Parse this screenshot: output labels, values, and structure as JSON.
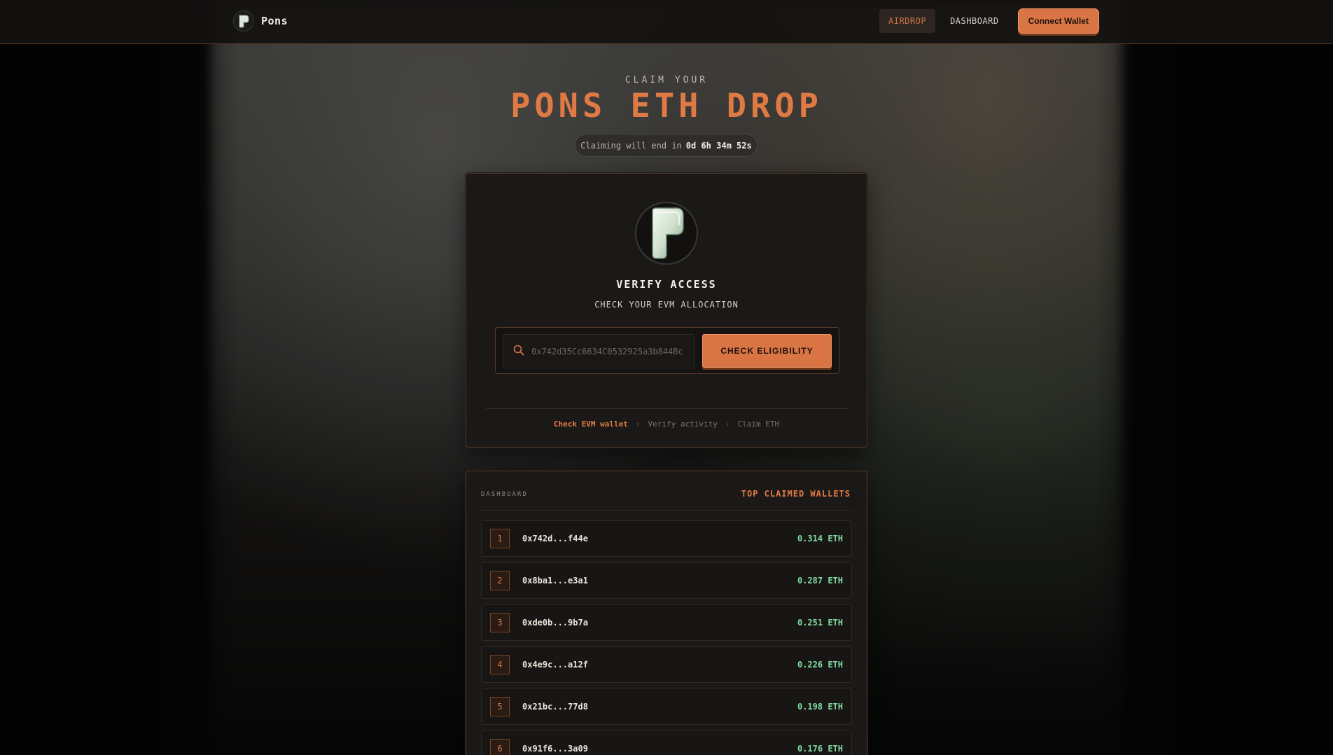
{
  "nav": {
    "brand": "Pons",
    "links": [
      {
        "label": "AIRDROP",
        "active": true
      },
      {
        "label": "DASHBOARD",
        "active": false
      }
    ],
    "connect_label": "Connect Wallet"
  },
  "hero": {
    "eyebrow": "CLAIM YOUR",
    "title": "PONS ETH DROP",
    "countdown_prefix": "Claiming will end in",
    "countdown_time": "0d 6h 34m 52s"
  },
  "verify": {
    "title": "VERIFY ACCESS",
    "subtitle": "CHECK YOUR EVM ALLOCATION",
    "input_placeholder": "0x742d35Cc6634C0532925a3b844Bc",
    "button_label": "CHECK ELIGIBILITY",
    "steps": [
      "Check EVM wallet",
      "Verify activity",
      "Claim ETH"
    ]
  },
  "dashboard": {
    "label": "DASHBOARD",
    "title": "TOP CLAIMED WALLETS",
    "rows": [
      {
        "rank": "1",
        "wallet": "0x742d...f44e",
        "amount": "0.314 ETH"
      },
      {
        "rank": "2",
        "wallet": "0x8ba1...e3a1",
        "amount": "0.287 ETH"
      },
      {
        "rank": "3",
        "wallet": "0xde0b...9b7a",
        "amount": "0.251 ETH"
      },
      {
        "rank": "4",
        "wallet": "0x4e9c...a12f",
        "amount": "0.226 ETH"
      },
      {
        "rank": "5",
        "wallet": "0x21bc...77d8",
        "amount": "0.198 ETH"
      },
      {
        "rank": "6",
        "wallet": "0x91f6...3a09",
        "amount": "0.176 ETH"
      }
    ]
  },
  "colors": {
    "accent": "#e07a45",
    "positive": "#7fd9a0",
    "background": "#050505"
  }
}
